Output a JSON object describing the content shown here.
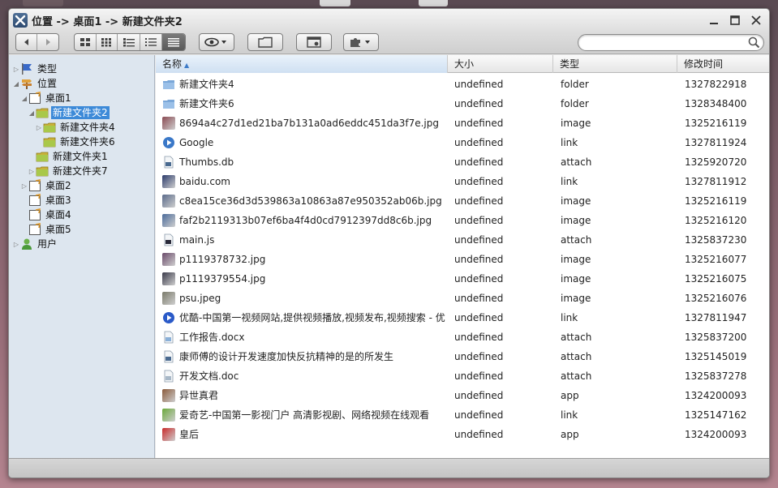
{
  "window": {
    "title": "位置 -> 桌面1 -> 新建文件夹2"
  },
  "search": {
    "value": "",
    "placeholder": ""
  },
  "sidebar": {
    "items": [
      {
        "label": "类型",
        "icon": "flag-icon",
        "level": 0,
        "arrow": "collapsed"
      },
      {
        "label": "位置",
        "icon": "signpost-icon",
        "level": 0,
        "arrow": "expanded"
      },
      {
        "label": "桌面1",
        "icon": "desktop-icon",
        "level": 1,
        "arrow": "expanded"
      },
      {
        "label": "新建文件夹2",
        "icon": "folder-icon",
        "level": 2,
        "arrow": "expanded",
        "selected": true
      },
      {
        "label": "新建文件夹4",
        "icon": "folder-icon",
        "level": 3,
        "arrow": "collapsed"
      },
      {
        "label": "新建文件夹6",
        "icon": "folder-icon",
        "level": 3,
        "arrow": "none"
      },
      {
        "label": "新建文件夹1",
        "icon": "folder-icon",
        "level": 2,
        "arrow": "none"
      },
      {
        "label": "新建文件夹7",
        "icon": "folder-icon",
        "level": 2,
        "arrow": "collapsed"
      },
      {
        "label": "桌面2",
        "icon": "desktop-icon",
        "level": 1,
        "arrow": "collapsed"
      },
      {
        "label": "桌面3",
        "icon": "desktop-icon",
        "level": 1,
        "arrow": "none"
      },
      {
        "label": "桌面4",
        "icon": "desktop-icon",
        "level": 1,
        "arrow": "none"
      },
      {
        "label": "桌面5",
        "icon": "desktop-icon",
        "level": 1,
        "arrow": "none"
      },
      {
        "label": "用户",
        "icon": "user-icon",
        "level": 0,
        "arrow": "collapsed"
      }
    ]
  },
  "columns": {
    "name": "名称",
    "size": "大小",
    "type": "类型",
    "mtime": "修改时间"
  },
  "files": [
    {
      "name": "新建文件夹4",
      "size": "undefined",
      "type": "folder",
      "mtime": "1327822918",
      "icon": "folder-icon",
      "color": "#7aa7d8"
    },
    {
      "name": "新建文件夹6",
      "size": "undefined",
      "type": "folder",
      "mtime": "1328348400",
      "icon": "folder-icon",
      "color": "#7aa7d8"
    },
    {
      "name": "8694a4c27d1ed21ba7b131a0ad6eddc451da3f7e.jpg",
      "size": "undefined",
      "type": "image",
      "mtime": "1325216119",
      "icon": "image-thumb-icon",
      "color": "#8a4a52"
    },
    {
      "name": "Google",
      "size": "undefined",
      "type": "link",
      "mtime": "1327811924",
      "icon": "google-icon",
      "color": "#3a78c8"
    },
    {
      "name": "Thumbs.db",
      "size": "undefined",
      "type": "attach",
      "mtime": "1325920720",
      "icon": "db-file-icon",
      "color": "#4a6a90"
    },
    {
      "name": "baidu.com",
      "size": "undefined",
      "type": "link",
      "mtime": "1327811912",
      "icon": "baidu-icon",
      "color": "#2a3a6a"
    },
    {
      "name": "c8ea15ce36d3d539863a10863a87e950352ab06b.jpg",
      "size": "undefined",
      "type": "image",
      "mtime": "1325216119",
      "icon": "image-thumb-icon",
      "color": "#5a6a8a"
    },
    {
      "name": "faf2b2119313b07ef6ba4f4d0cd7912397dd8c6b.jpg",
      "size": "undefined",
      "type": "image",
      "mtime": "1325216120",
      "icon": "image-thumb-icon",
      "color": "#4a6a9a"
    },
    {
      "name": "main.js",
      "size": "undefined",
      "type": "attach",
      "mtime": "1325837230",
      "icon": "js-file-icon",
      "color": "#2a2a3a"
    },
    {
      "name": "p1119378732.jpg",
      "size": "undefined",
      "type": "image",
      "mtime": "1325216077",
      "icon": "image-thumb-icon",
      "color": "#6a4a6a"
    },
    {
      "name": "p1119379554.jpg",
      "size": "undefined",
      "type": "image",
      "mtime": "1325216075",
      "icon": "image-thumb-icon",
      "color": "#3a3a4a"
    },
    {
      "name": "psu.jpeg",
      "size": "undefined",
      "type": "image",
      "mtime": "1325216076",
      "icon": "image-thumb-icon",
      "color": "#7a7a6a"
    },
    {
      "name": "优酷-中国第一视频网站,提供视频播放,视频发布,视频搜索 - 优",
      "size": "undefined",
      "type": "link",
      "mtime": "1327811947",
      "icon": "youku-icon",
      "color": "#2a5ac8"
    },
    {
      "name": "工作报告.docx",
      "size": "undefined",
      "type": "attach",
      "mtime": "1325837200",
      "icon": "docx-file-icon",
      "color": "#8ab0d8"
    },
    {
      "name": "康师傅的设计开发速度加快反抗精神的是的所发生",
      "size": "undefined",
      "type": "attach",
      "mtime": "1325145019",
      "icon": "file-icon",
      "color": "#4a6a90"
    },
    {
      "name": "开发文档.doc",
      "size": "undefined",
      "type": "attach",
      "mtime": "1325837278",
      "icon": "doc-file-icon",
      "color": "#a8b8c8"
    },
    {
      "name": "异世真君",
      "size": "undefined",
      "type": "app",
      "mtime": "1324200093",
      "icon": "app-icon",
      "color": "#8a5a3a"
    },
    {
      "name": "爱奇艺-中国第一影视门户 高清影视剧、网络视频在线观看",
      "size": "undefined",
      "type": "link",
      "mtime": "1325147162",
      "icon": "iqiyi-icon",
      "color": "#6aa83a"
    },
    {
      "name": "皇后",
      "size": "undefined",
      "type": "app",
      "mtime": "1324200093",
      "icon": "app-icon",
      "color": "#c82a2a"
    }
  ]
}
